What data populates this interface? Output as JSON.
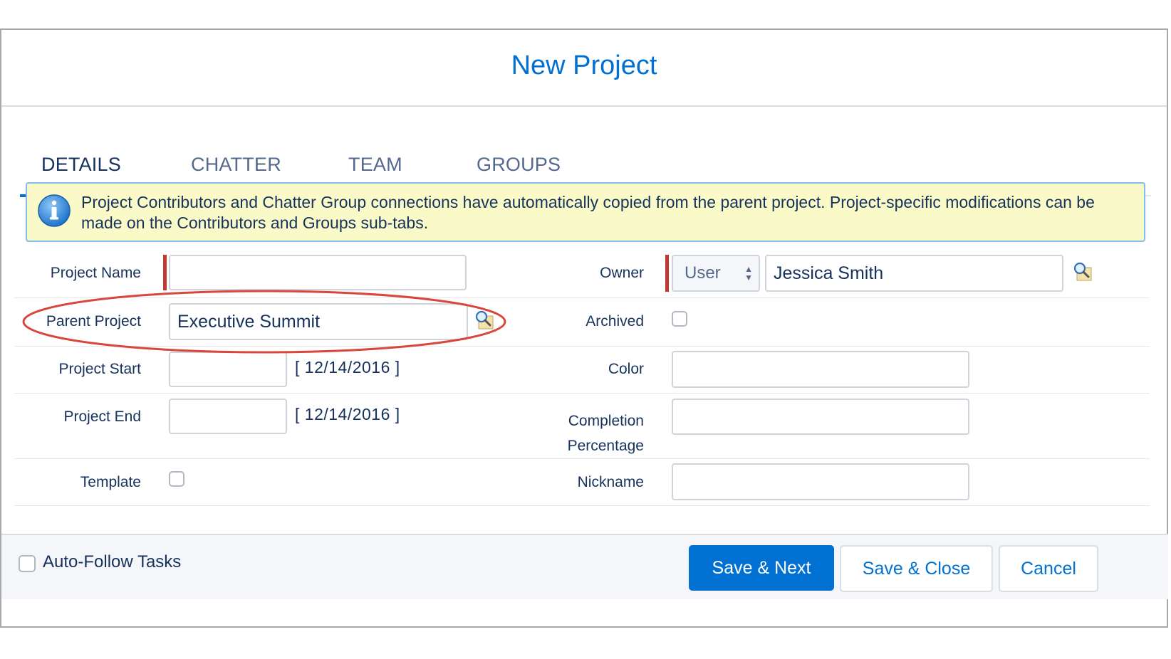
{
  "dialog": {
    "title": "New Project"
  },
  "tabs": [
    {
      "label": "DETAILS",
      "active": true
    },
    {
      "label": "CHATTER",
      "active": false
    },
    {
      "label": "TEAM",
      "active": false
    },
    {
      "label": "GROUPS",
      "active": false
    }
  ],
  "notice": {
    "icon": "info-icon",
    "text": "Project Contributors and Chatter Group connections have automatically copied from the parent project. Project-specific modifications can be made on the Contributors and Groups sub-tabs."
  },
  "form": {
    "project_name": {
      "label": "Project Name",
      "value": "",
      "required": true
    },
    "parent_project": {
      "label": "Parent Project",
      "value": "Executive Summit"
    },
    "project_start": {
      "label": "Project Start",
      "value": "",
      "hint": "[ 12/14/2016 ]"
    },
    "project_end": {
      "label": "Project End",
      "value": "",
      "hint": "[ 12/14/2016 ]"
    },
    "template": {
      "label": "Template",
      "checked": false
    },
    "owner": {
      "label": "Owner",
      "type_value": "User",
      "value": "Jessica Smith",
      "required": true
    },
    "archived": {
      "label": "Archived",
      "checked": false
    },
    "color": {
      "label": "Color",
      "value": ""
    },
    "completion": {
      "label_line1": "Completion",
      "label_line2": "Percentage",
      "value": ""
    },
    "nickname": {
      "label": "Nickname",
      "value": ""
    }
  },
  "footer": {
    "auto_follow_label": "Auto-Follow Tasks",
    "auto_follow_checked": false,
    "save_next": "Save & Next",
    "save_close": "Save & Close",
    "cancel": "Cancel"
  },
  "colors": {
    "brand": "#0070d2",
    "required": "#c23934",
    "notice_bg": "#fafac8",
    "annotation": "#d9463b"
  }
}
